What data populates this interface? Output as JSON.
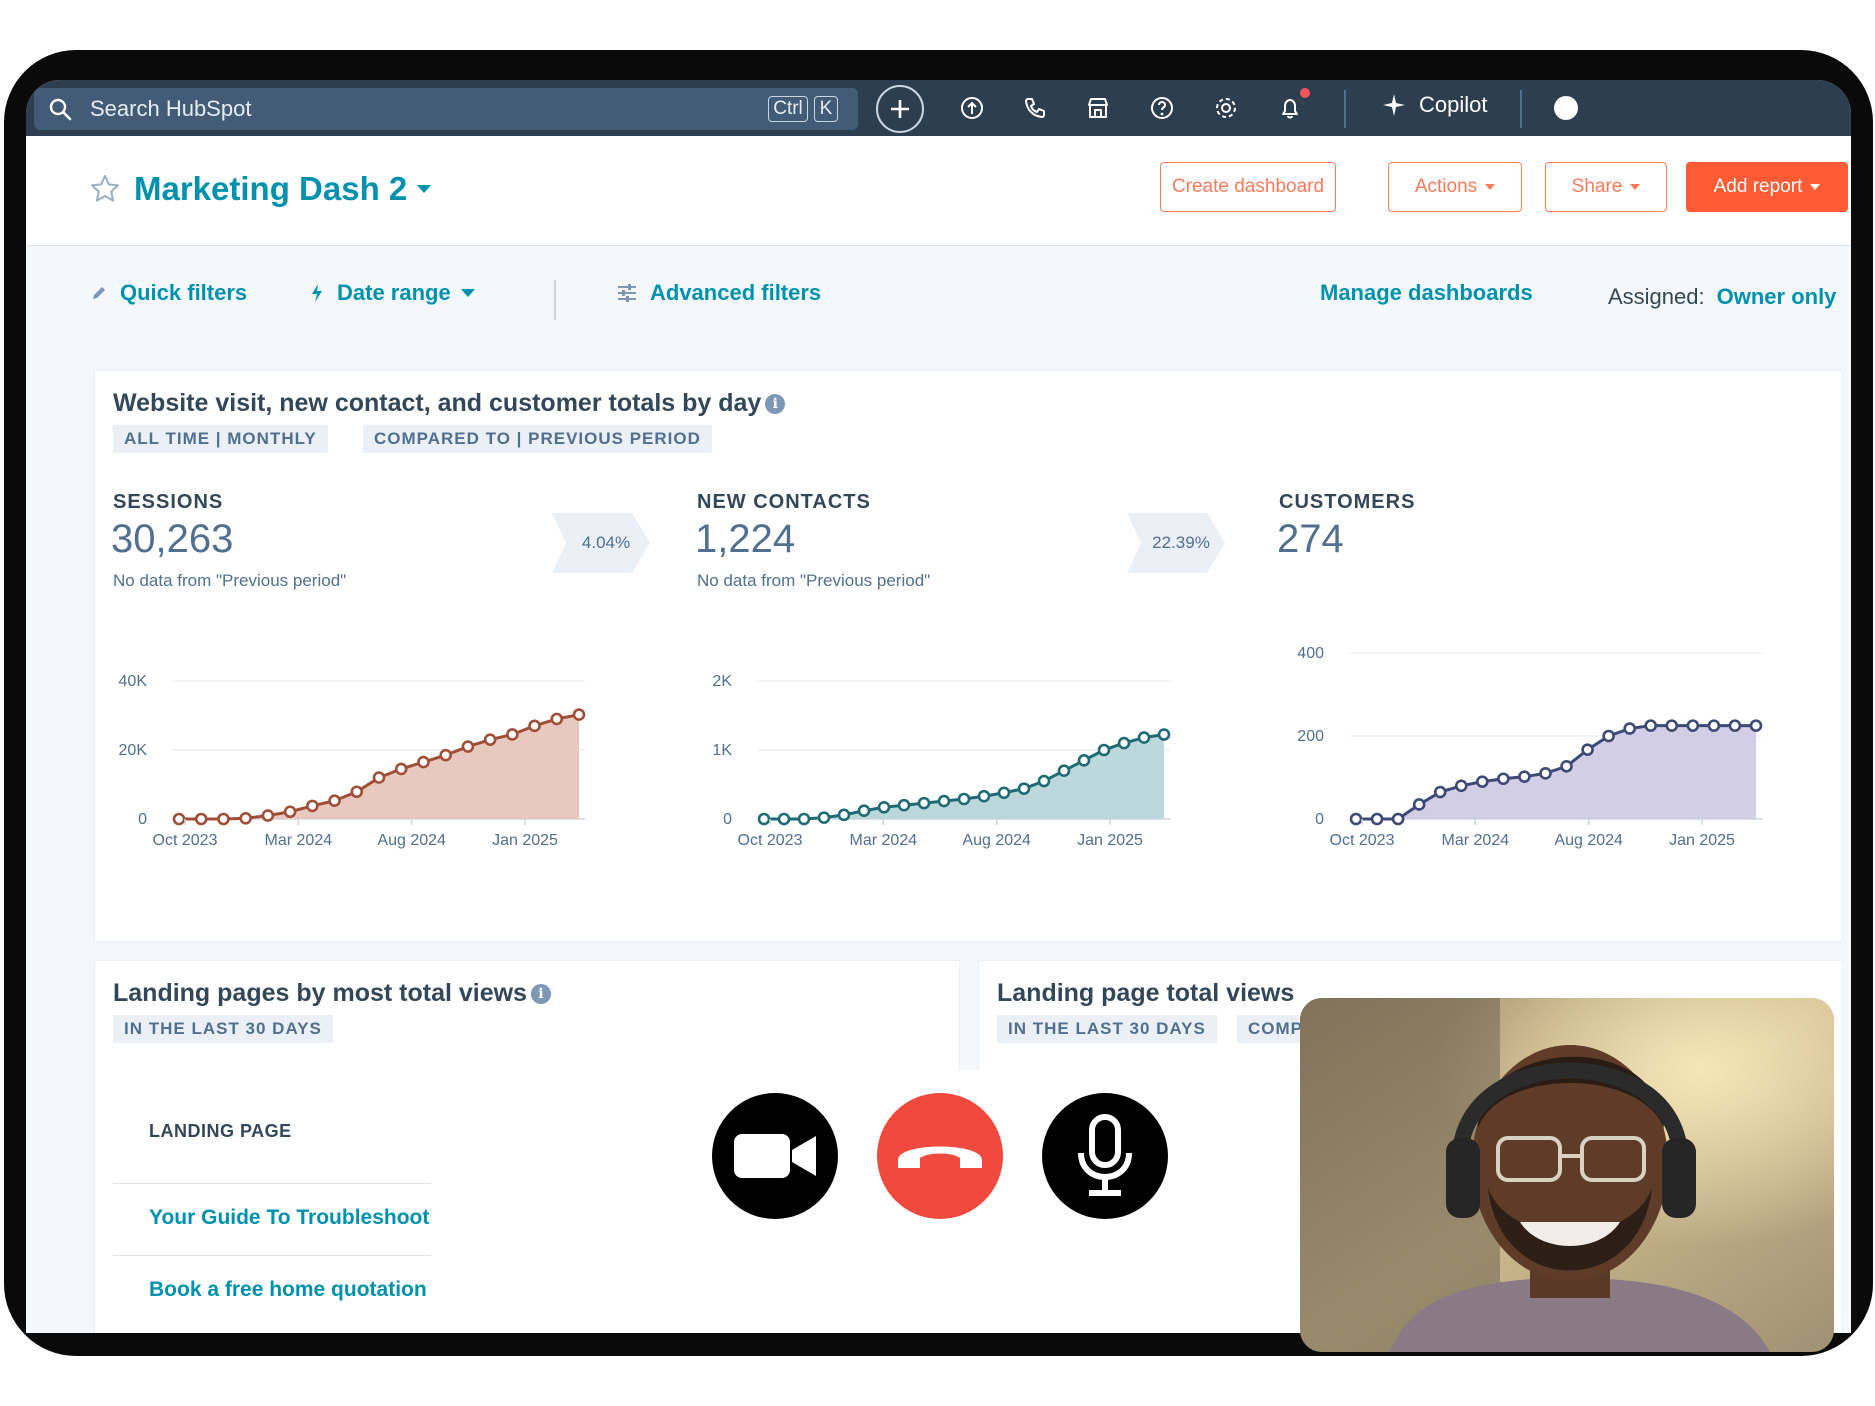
{
  "nav": {
    "search_placeholder": "Search HubSpot",
    "shortcut_ctrl": "Ctrl",
    "shortcut_k": "K",
    "copilot_label": "Copilot"
  },
  "header": {
    "title": "Marketing Dash 2",
    "buttons": {
      "create_dashboard": "Create dashboard",
      "actions": "Actions",
      "share": "Share",
      "add_report": "Add report"
    }
  },
  "filters": {
    "quick_filters": "Quick filters",
    "date_range": "Date range",
    "advanced_filters": "Advanced filters",
    "manage_dashboards": "Manage dashboards",
    "assigned_label": "Assigned:",
    "assigned_value": "Owner only"
  },
  "report1": {
    "title": "Website visit, new contact, and customer totals by day",
    "tag_range": "ALL TIME | MONTHLY",
    "tag_compare": "COMPARED TO | PREVIOUS PERIOD",
    "sessions": {
      "label": "SESSIONS",
      "value": "30,263",
      "note": "No data from \"Previous period\"",
      "delta": "4.04%"
    },
    "contacts": {
      "label": "NEW CONTACTS",
      "value": "1,224",
      "note": "No data from \"Previous period\"",
      "delta": "22.39%"
    },
    "customers": {
      "label": "CUSTOMERS",
      "value": "274"
    }
  },
  "chart_data": [
    {
      "type": "area",
      "series": [
        {
          "name": "Sessions",
          "values": [
            0,
            0,
            0,
            200,
            1000,
            2100,
            3800,
            5300,
            7900,
            12000,
            14500,
            16500,
            18500,
            21000,
            23000,
            24500,
            27000,
            29000,
            30263
          ]
        }
      ],
      "x_ticks": [
        "Oct 2023",
        "Mar 2024",
        "Aug 2024",
        "Jan 2025"
      ],
      "y_ticks": [
        "0",
        "20K",
        "40K"
      ],
      "ylim": [
        0,
        40000
      ],
      "color": "#a04f36",
      "fill": "#e7c6bd"
    },
    {
      "type": "area",
      "series": [
        {
          "name": "New contacts",
          "values": [
            0,
            0,
            0,
            20,
            60,
            120,
            170,
            200,
            230,
            260,
            290,
            330,
            380,
            440,
            550,
            700,
            850,
            1000,
            1100,
            1180,
            1224
          ]
        }
      ],
      "x_ticks": [
        "Oct 2023",
        "Mar 2024",
        "Aug 2024",
        "Jan 2025"
      ],
      "y_ticks": [
        "0",
        "1K",
        "2K"
      ],
      "ylim": [
        0,
        2000
      ],
      "color": "#1f6b75",
      "fill": "#b9d6d8"
    },
    {
      "type": "area",
      "series": [
        {
          "name": "Customers",
          "values": [
            0,
            0,
            0,
            35,
            65,
            80,
            90,
            97,
            102,
            110,
            127,
            167,
            200,
            218,
            225,
            225,
            225,
            225,
            225,
            225
          ]
        }
      ],
      "x_ticks": [
        "Oct 2023",
        "Mar 2024",
        "Aug 2024",
        "Jan 2025"
      ],
      "y_ticks": [
        "0",
        "200",
        "400"
      ],
      "ylim": [
        0,
        400
      ],
      "color": "#3d4a78",
      "fill": "#cfcbe4"
    }
  ],
  "report2": {
    "title": "Landing pages by most total views",
    "tag": "IN THE LAST 30 DAYS",
    "column_header": "LANDING PAGE",
    "rows": [
      "Your Guide To Troubleshooting",
      "Book a free home quotation"
    ]
  },
  "report3": {
    "title": "Landing page total views",
    "tag": "IN THE LAST 30 DAYS",
    "tag2": "COMPARED TO"
  }
}
